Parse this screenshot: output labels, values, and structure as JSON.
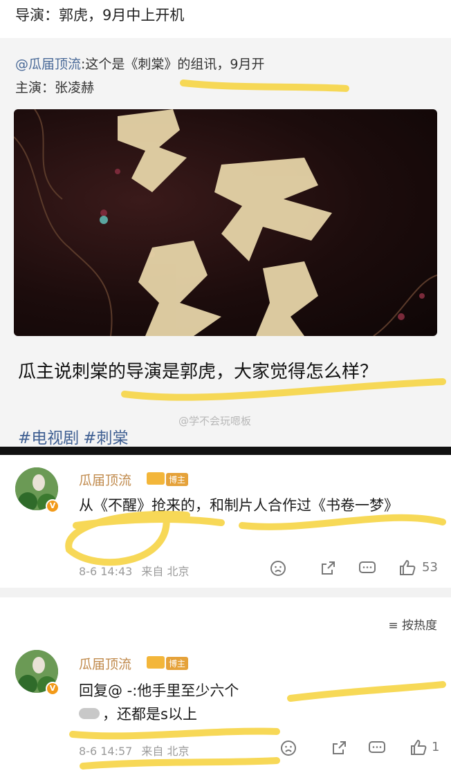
{
  "top_line": "导演：郭虎，9月中上开机",
  "repost": {
    "user": "@瓜届顶流",
    "text": ":这个是《刺棠》的组讯，9月开",
    "line2": "主演：张凌赫"
  },
  "question": "瓜主说刺棠的导演是郭虎，大家觉得怎么样？",
  "tags": [
    "#电视剧",
    "#刺棠"
  ],
  "watermark": "@学不会玩嗯板",
  "comments": [
    {
      "name": "瓜届顶流",
      "badge": "博主",
      "text": "从《不醒》抢来的，和制片人合作过《书卷一梦》",
      "time": "8-6 14:43",
      "location": "来自 北京",
      "likes": "53"
    },
    {
      "name": "瓜届顶流",
      "badge": "博主",
      "text": "回复@ -:他手里至少六个",
      "text2": "，还都是s以上",
      "time": "8-6 14:57",
      "location": "来自 北京",
      "likes": "1"
    }
  ],
  "sort_label": "按热度",
  "icons": {
    "dislike": "dislike-icon",
    "share": "share-icon",
    "comment": "comment-icon",
    "like": "like-icon",
    "sort": "sort-icon",
    "verified": "verified-badge-icon",
    "crown": "crown-icon"
  },
  "colors": {
    "highlight": "#f6d23a",
    "link": "#3f5f92",
    "name": "#c08a4c"
  }
}
